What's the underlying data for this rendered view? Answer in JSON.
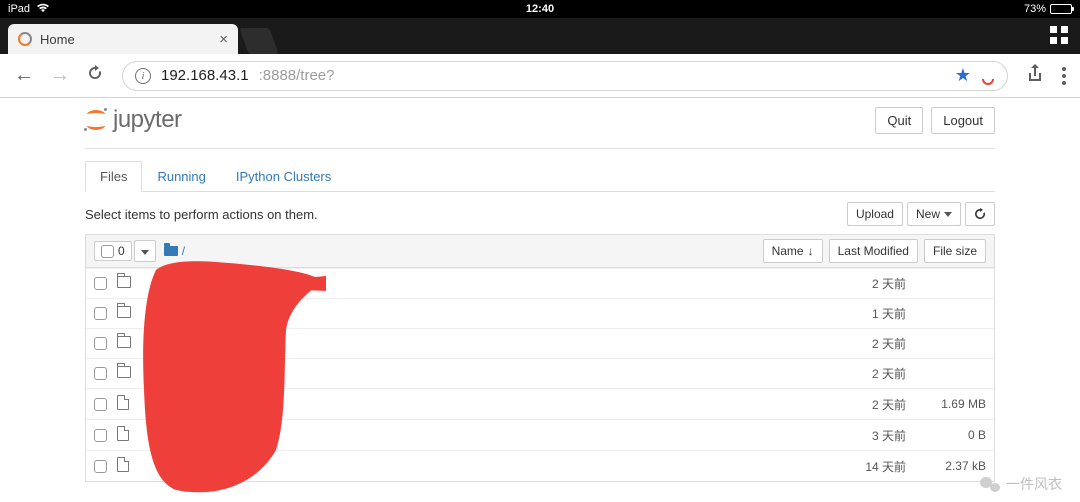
{
  "statusbar": {
    "device": "iPad",
    "time": "12:40",
    "battery_pct": "73%"
  },
  "browser": {
    "tab_title": "Home",
    "url_host": "192.168.43.1",
    "url_rest": ":8888/tree?"
  },
  "header": {
    "brand": "jupyter",
    "quit": "Quit",
    "logout": "Logout"
  },
  "tabs": {
    "files": "Files",
    "running": "Running",
    "clusters": "IPython Clusters"
  },
  "toolbar": {
    "hint": "Select items to perform actions on them.",
    "upload": "Upload",
    "new": "New",
    "select_count": "0",
    "breadcrumb": "/",
    "col_name": "Name",
    "col_modified": "Last Modified",
    "col_size": "File size"
  },
  "rows": [
    {
      "type": "folder",
      "modified": "2 天前",
      "size": ""
    },
    {
      "type": "folder",
      "modified": "1 天前",
      "size": ""
    },
    {
      "type": "folder",
      "modified": "2 天前",
      "size": ""
    },
    {
      "type": "folder",
      "modified": "2 天前",
      "size": ""
    },
    {
      "type": "file",
      "modified": "2 天前",
      "size": "1.69 MB"
    },
    {
      "type": "file",
      "modified": "3 天前",
      "size": "0 B"
    },
    {
      "type": "file",
      "modified": "14 天前",
      "size": "2.37 kB"
    }
  ],
  "watermark": "一件风衣"
}
